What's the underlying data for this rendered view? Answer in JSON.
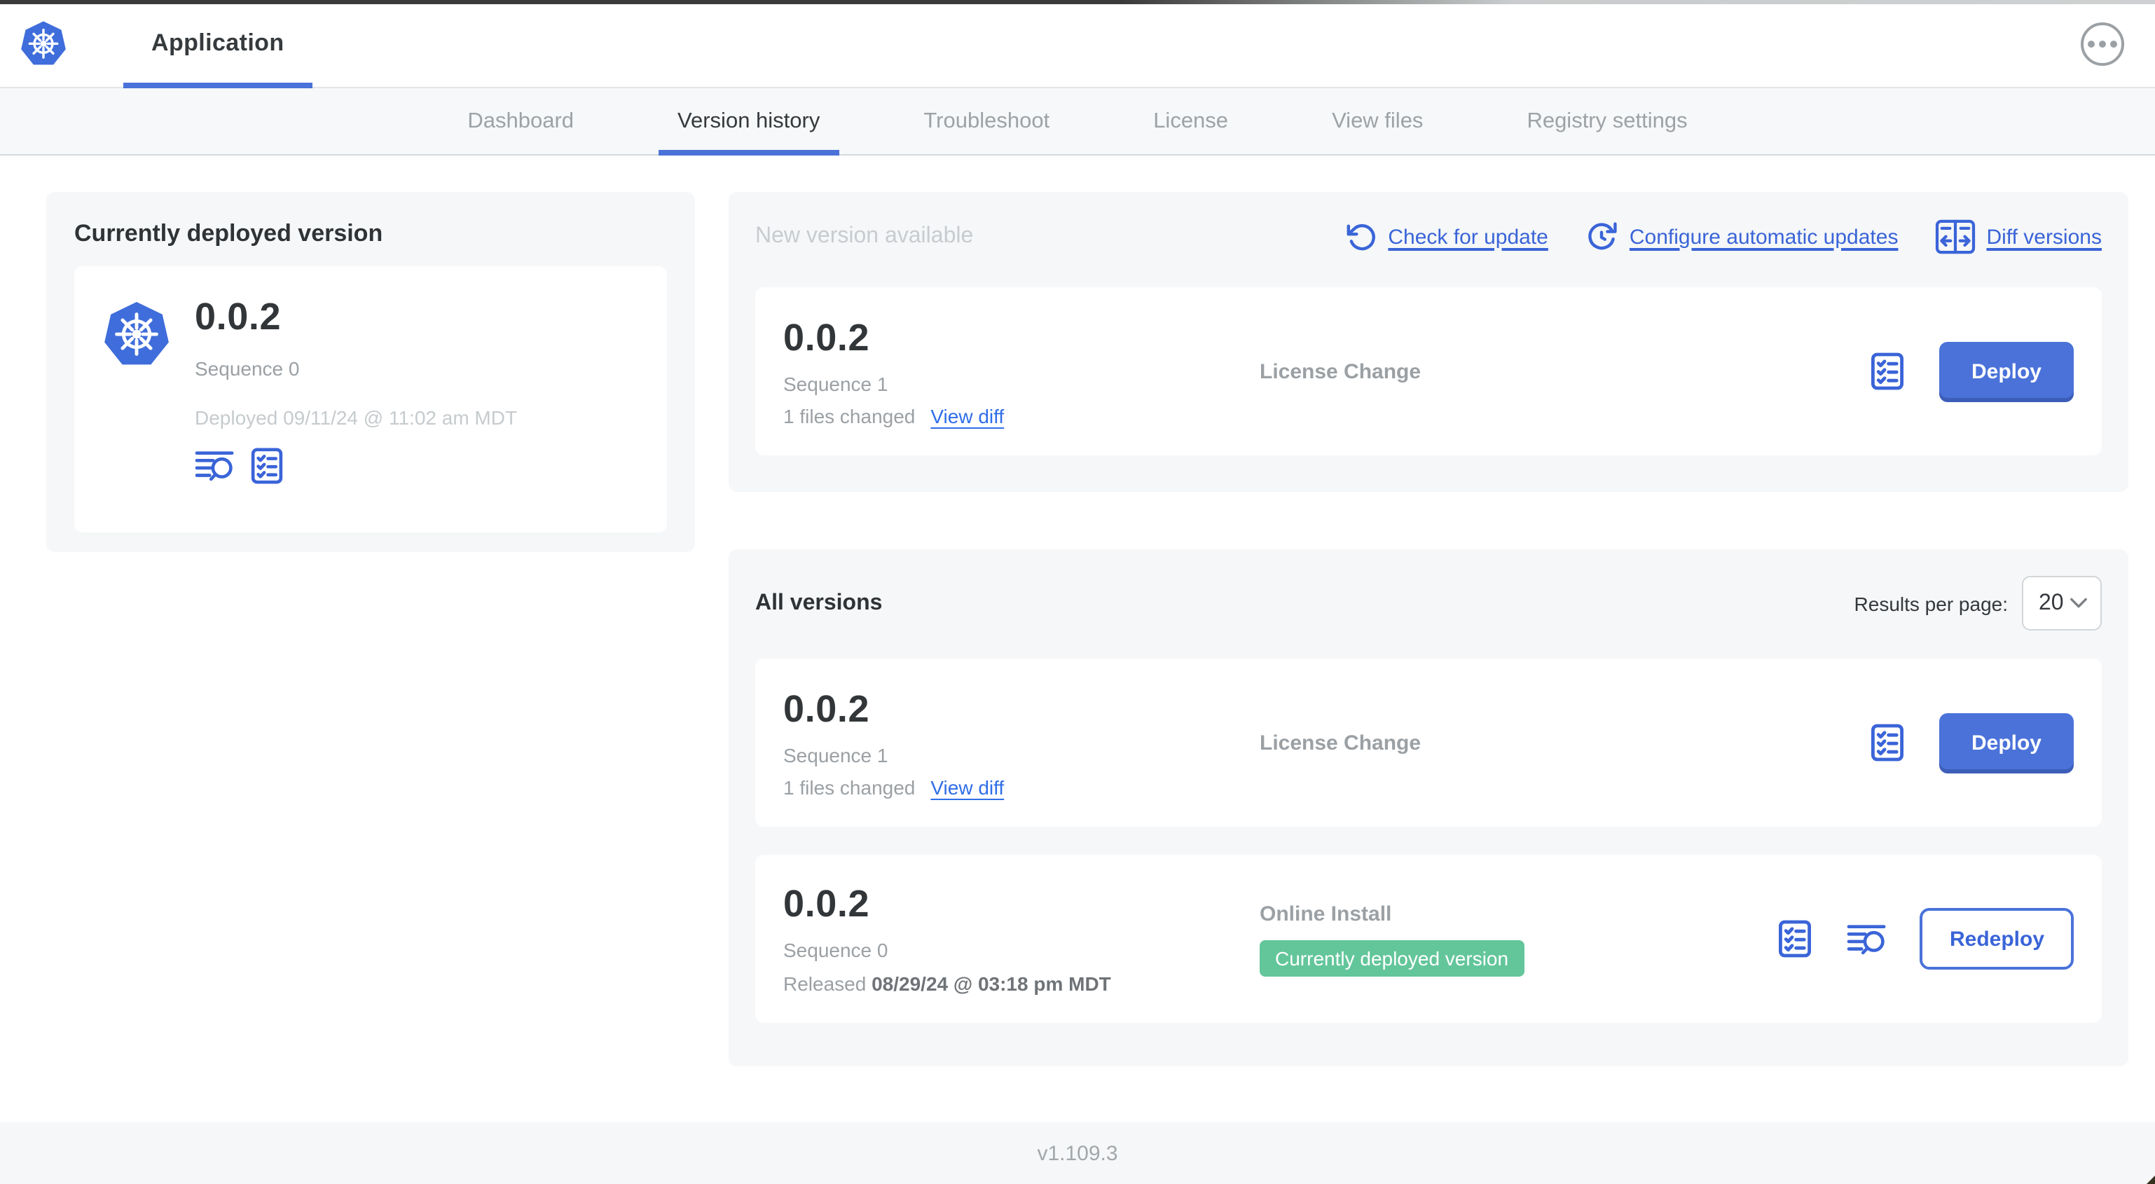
{
  "header": {
    "app_tab": "Application"
  },
  "nav": {
    "tabs": [
      {
        "label": "Dashboard",
        "active": false
      },
      {
        "label": "Version history",
        "active": true
      },
      {
        "label": "Troubleshoot",
        "active": false
      },
      {
        "label": "License",
        "active": false
      },
      {
        "label": "View files",
        "active": false
      },
      {
        "label": "Registry settings",
        "active": false
      }
    ]
  },
  "currently_deployed": {
    "heading": "Currently deployed version",
    "version": "0.0.2",
    "sequence": "Sequence 0",
    "deployed_at": "Deployed 09/11/24 @ 11:02 am MDT"
  },
  "new_version": {
    "heading": "New version available",
    "check_for_update": "Check for update",
    "configure_auto_updates": "Configure automatic updates",
    "diff_versions": "Diff versions",
    "card": {
      "version": "0.0.2",
      "sequence": "Sequence 1",
      "files_changed": "1 files changed",
      "view_diff": "View diff",
      "source": "License Change",
      "action": "Deploy"
    }
  },
  "all_versions": {
    "heading": "All versions",
    "results_per_page_label": "Results per page:",
    "results_per_page_value": "20",
    "rows": [
      {
        "version": "0.0.2",
        "sequence": "Sequence 1",
        "files_changed": "1 files changed",
        "view_diff": "View diff",
        "source": "License Change",
        "action": "Deploy"
      },
      {
        "version": "0.0.2",
        "sequence": "Sequence 0",
        "released_prefix": "Released ",
        "released_date": "08/29/24 @ 03:18 pm MDT",
        "source": "Online Install",
        "badge": "Currently deployed version",
        "action": "Redeploy"
      }
    ]
  },
  "footer": {
    "version": "v1.109.3"
  },
  "icons": {
    "logo": "kubernetes-wheel-icon",
    "header_menu": "ellipsis-icon",
    "check_for_update": "refresh-ccw-icon",
    "configure_auto_updates": "clock-refresh-icon",
    "diff_versions": "diff-columns-icon",
    "config": "checklist-icon",
    "logs": "lines-magnifier-icon",
    "select": "chevron-down-icon"
  },
  "colors": {
    "accent_blue": "#3a64d8",
    "button_blue": "#4a72d9",
    "badge_green": "#63c69a",
    "kubernetes_blue": "#3f6ddb",
    "panel_bg": "#f5f7f8"
  }
}
